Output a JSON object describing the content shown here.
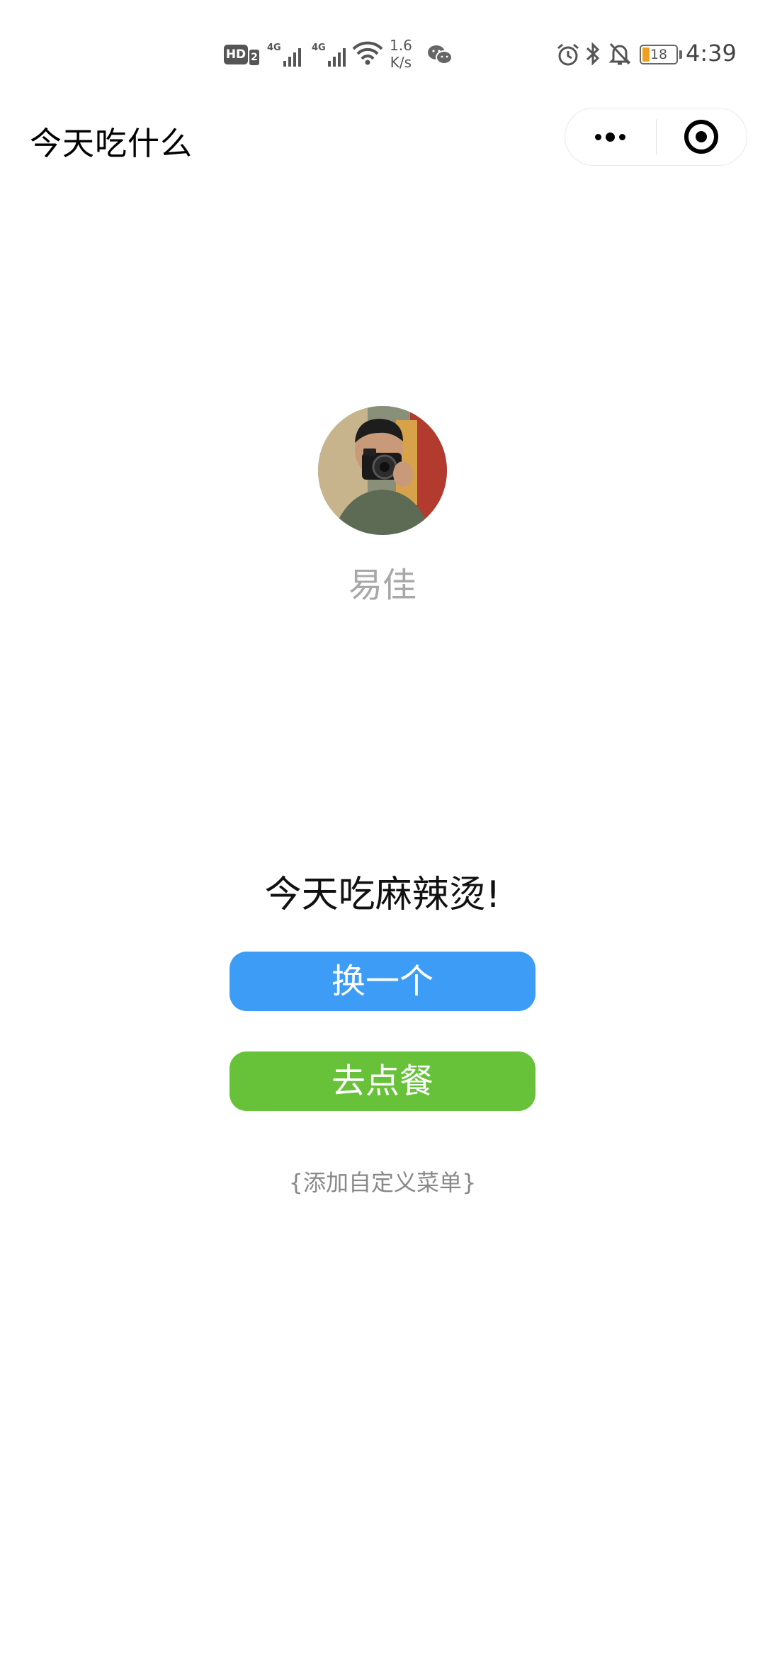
{
  "status_bar": {
    "hd_label": "HD",
    "hd_sub": "2",
    "network_1": "4G",
    "network_2": "4G",
    "speed_value": "1.6",
    "speed_unit": "K/s",
    "battery_level": "18",
    "time": "4:39",
    "icons": [
      "hd-icon",
      "signal-icon",
      "wifi-icon",
      "wechat-icon",
      "alarm-icon",
      "bluetooth-icon",
      "mute-icon",
      "battery-icon"
    ]
  },
  "nav": {
    "title": "今天吃什么",
    "capsule_icons": [
      "more-icon",
      "close-target-icon"
    ]
  },
  "profile": {
    "name": "易佳",
    "avatar_icon": "avatar-photo"
  },
  "main": {
    "suggestion": "今天吃麻辣烫!",
    "change_button": "换一个",
    "order_button": "去点餐",
    "add_menu_link": "{添加自定义菜单}"
  },
  "colors": {
    "change_button_bg": "#3d9cf5",
    "order_button_bg": "#67c23a",
    "name_text": "#a8a8a8",
    "link_text": "#888888"
  }
}
